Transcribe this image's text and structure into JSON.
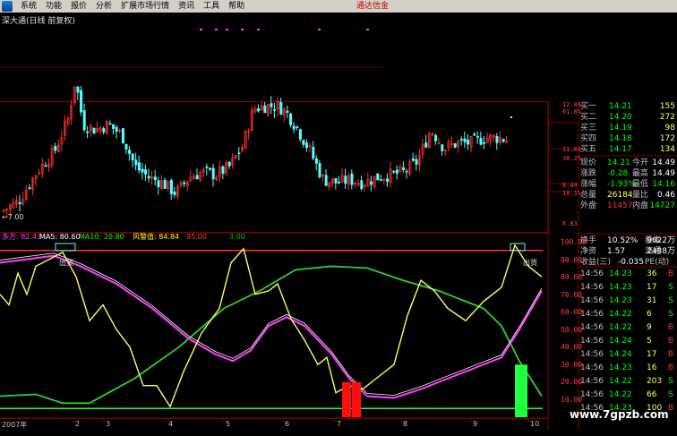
{
  "menu": {
    "items": [
      "系统",
      "功能",
      "报价",
      "分析",
      "扩展市场行情",
      "资讯",
      "工具",
      "帮助"
    ],
    "brand": "通达信金"
  },
  "chart": {
    "title": "深大通(日线 前复权)",
    "low_label": "7.00"
  },
  "price_axis": [
    {
      "value": "12.04",
      "sub": ""
    },
    {
      "value": "61.8%",
      "sub": ""
    },
    {
      "value": "11.04",
      "sub": ""
    },
    {
      "value": "38.2%",
      "sub": ""
    },
    {
      "value": "8.44",
      "sub": ""
    },
    {
      "value": "18.1%",
      "sub": ""
    },
    {
      "value": "6.83",
      "sub": ""
    }
  ],
  "quote": {
    "bids_asks": [
      {
        "label": "买一",
        "price": "14.21",
        "vol": "155"
      },
      {
        "label": "买二",
        "price": "14.20",
        "vol": "272"
      },
      {
        "label": "买三",
        "price": "14.19",
        "vol": "98"
      },
      {
        "label": "买四",
        "price": "14.18",
        "vol": "172"
      },
      {
        "label": "买五",
        "price": "14.17",
        "vol": "134"
      }
    ],
    "stats": [
      {
        "l1": "现价",
        "v1": "14.21",
        "l2": "今开",
        "v2": "14.49"
      },
      {
        "l1": "涨跌",
        "v1": "-0.28",
        "l2": "最高",
        "v2": "14.49"
      },
      {
        "l1": "涨幅",
        "v1": "-1.93%",
        "l2": "最低",
        "v2": "14.16"
      },
      {
        "l1": "总量",
        "v1": "26184",
        "l2": "量比",
        "v2": "0.46"
      },
      {
        "l1": "外盘",
        "v1": "11457",
        "l2": "内盘",
        "v2": "14727"
      }
    ],
    "stats2": [
      {
        "l1": "换手",
        "v1": "10.52%",
        "l2": "股本",
        "v2": "9622万"
      },
      {
        "l1": "净资",
        "v1": "1.57",
        "l2": "流通",
        "v2": "2488万"
      },
      {
        "l1": "收益(三)",
        "v1": "-0.035",
        "l2": "PE(动)",
        "v2": ""
      }
    ]
  },
  "ticks": [
    {
      "time": "14:56",
      "price": "14.23",
      "vol": "36",
      "side": "B"
    },
    {
      "time": "14:56",
      "price": "14.23",
      "vol": "17",
      "side": "S"
    },
    {
      "time": "14:56",
      "price": "14.23",
      "vol": "31",
      "side": "S"
    },
    {
      "time": "14:56",
      "price": "14.22",
      "vol": "6",
      "side": "S"
    },
    {
      "time": "14:56",
      "price": "14.22",
      "vol": "9",
      "side": "B"
    },
    {
      "time": "14:56",
      "price": "14.24",
      "vol": "5",
      "side": "B"
    },
    {
      "time": "14:56",
      "price": "14.24",
      "vol": "17",
      "side": "B"
    },
    {
      "time": "14:56",
      "price": "14.23",
      "vol": "16",
      "side": "B"
    },
    {
      "time": "14:56",
      "price": "14.22",
      "vol": "203",
      "side": "S"
    },
    {
      "time": "14:56",
      "price": "14.22",
      "vol": "66",
      "side": "S"
    },
    {
      "time": "14:56",
      "price": "14.23",
      "vol": "100",
      "side": "B"
    }
  ],
  "indicator": {
    "legend": [
      {
        "text": "多方: 82.43",
        "color": "#ff40ff"
      },
      {
        "text": "MA5: 80.60",
        "color": "#ffffff"
      },
      {
        "text": "MA10: 20.80",
        "color": "#00ff00"
      },
      {
        "text": "风警值: 84.84",
        "color": "#ffff00"
      },
      {
        "text": "95.00",
        "color": "#ff4040"
      },
      {
        "text": "3.00",
        "color": "#00c000"
      }
    ],
    "axis": [
      "100.00",
      "90.00",
      "80.00",
      "70.00",
      "60.00",
      "50.00",
      "40.00",
      "30.00",
      "20.00",
      "10.00"
    ],
    "labels": [
      "出货",
      "出货"
    ]
  },
  "dates": [
    "2007年",
    "2",
    "3",
    "4",
    "5",
    "6",
    "7",
    "8",
    "9",
    "10"
  ],
  "watermark": "www.7gpzb.com",
  "colors": {
    "up": "#ff3030",
    "down": "#54ffff",
    "grid": "#800000",
    "yellow_line": "#ffff60",
    "magenta_line": "#ff40ff",
    "green_line": "#30d030"
  }
}
